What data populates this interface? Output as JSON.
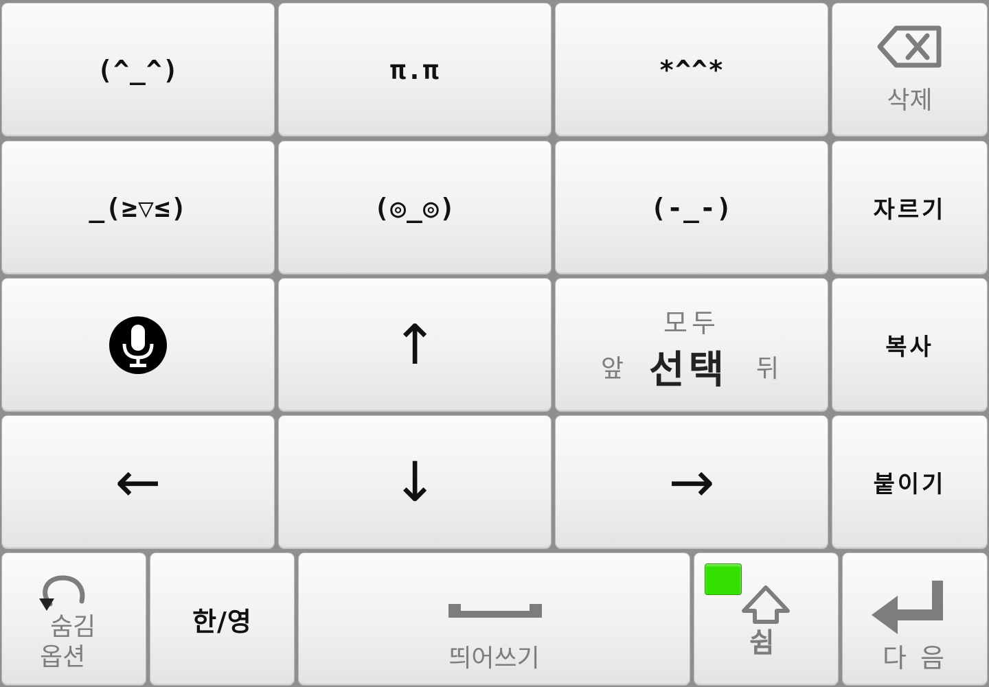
{
  "row1": {
    "k1": "(^_^)",
    "k2": "π.π",
    "k3": "*^^*",
    "delete_label": "삭제"
  },
  "row2": {
    "k1": "_(≥▽≤)",
    "k2": "(◎_◎)",
    "k3": "(-_-)",
    "cut_label": "자르기"
  },
  "row3": {
    "up_arrow": "↑",
    "select_top": "모두",
    "select_front": "앞",
    "select_main": "선택",
    "select_back": "뒤",
    "copy_label": "복사"
  },
  "row4": {
    "left_arrow": "←",
    "down_arrow": "↓",
    "right_arrow": "→",
    "paste_label": "붙이기"
  },
  "row5": {
    "hide_label": "숨김",
    "option_label": "옵션",
    "lang_label": "한/영",
    "space_label": "띄어쓰기",
    "shift_label": "쉼",
    "next_label": "다 음"
  },
  "icons": {
    "mic": "microphone-icon",
    "backspace": "backspace-icon",
    "shift": "shift-arrow-icon",
    "enter": "enter-icon",
    "space": "space-bar-icon",
    "hide": "undo-hide-icon"
  },
  "colors": {
    "indicator": "#33e000",
    "key_text": "#111111",
    "secondary_text": "#7d7d7d"
  }
}
